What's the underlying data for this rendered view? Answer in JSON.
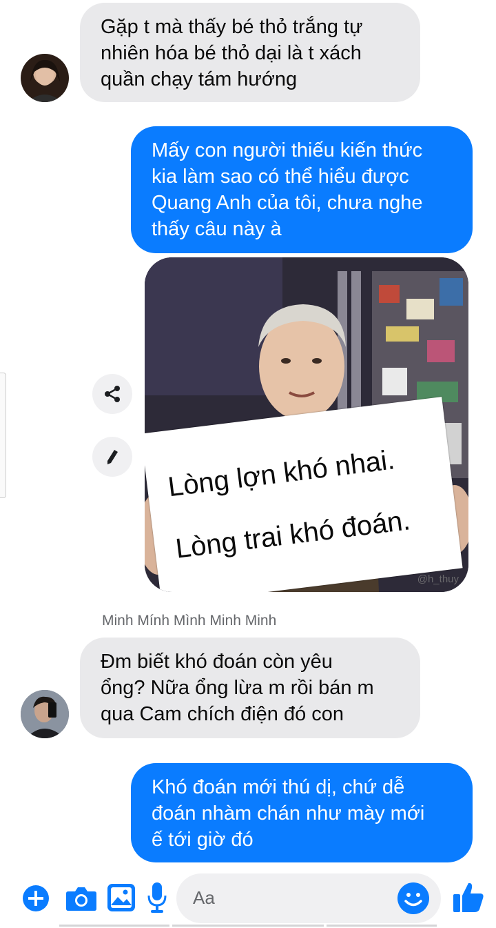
{
  "messages": [
    {
      "side": "in",
      "text": "Gặp t mà thấy bé thỏ trắng tự\nnhiên hóa bé thỏ dại là t xách\nquần chạy tám hướng"
    },
    {
      "side": "out",
      "text": "Mấy con người thiếu kiến thức\nkia làm sao có thể hiểu được\nQuang Anh của tôi, chưa nghe\nthấy câu này à"
    },
    {
      "side": "in",
      "sender": "Minh Mính Mình Minh Minh",
      "text": "Đm biết khó đoán còn yêu\nổng? Nữa ổng lừa m rồi bán m\nqua Cam chích điện đó con"
    },
    {
      "side": "out",
      "text": "Khó đoán mới thú dị, chứ dễ\nđoán nhàm chán như mày mới\nế tới giờ đó"
    }
  ],
  "image_message": {
    "sign_line_1": "Lòng lợn khó nhai.",
    "sign_line_2": "Lòng trai khó đoán.",
    "watermark": "@h_thuy"
  },
  "side_actions": [
    "share-icon",
    "pencil-icon"
  ],
  "composer": {
    "placeholder": "Aa",
    "icons": [
      "plus-icon",
      "camera-icon",
      "gallery-icon",
      "microphone-icon",
      "emoji-icon",
      "thumbs-up-icon"
    ]
  },
  "colors": {
    "accent": "#0a7cff",
    "incoming_bg": "#e9e9eb"
  }
}
